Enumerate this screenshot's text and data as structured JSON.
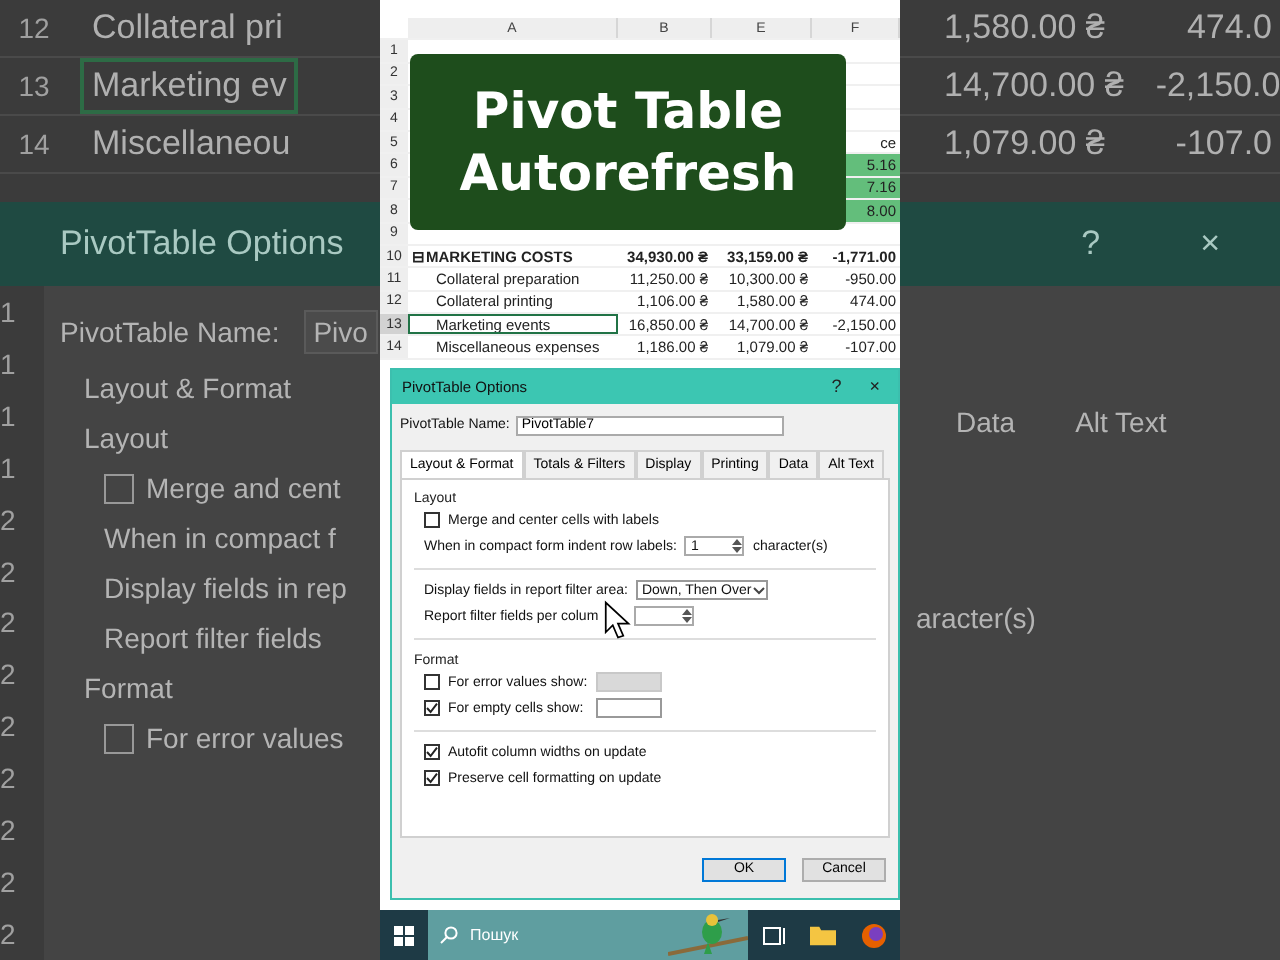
{
  "backdrop_left": {
    "rows": [
      {
        "number": "12",
        "label": "Collateral pri",
        "selected": false
      },
      {
        "number": "13",
        "label": "Marketing ev",
        "selected": true
      },
      {
        "number": "14",
        "label": "Miscellaneou",
        "selected": false
      }
    ],
    "dialog_title": "PivotTable Options",
    "name_label": "PivotTable Name:",
    "name_value": "Pivo",
    "tab": "Layout & Format",
    "section": "Layout",
    "lines": [
      {
        "kind": "check",
        "text": "Merge and cent",
        "checked": false
      },
      {
        "kind": "text",
        "text": "When in compact f"
      },
      {
        "kind": "text",
        "text": "Display fields in rep"
      },
      {
        "kind": "text",
        "text": "Report filter fields"
      },
      {
        "kind": "heading",
        "text": "Format"
      },
      {
        "kind": "check",
        "text": "For error values",
        "checked": false
      }
    ],
    "row_numbers": [
      "1",
      "1",
      "1",
      "1",
      "2",
      "2",
      "2",
      "2",
      "2",
      "2",
      "2",
      "2",
      "2"
    ]
  },
  "backdrop_right": {
    "rows": [
      [
        "1,580.00 ₴",
        "474.0"
      ],
      [
        "14,700.00 ₴",
        "-2,150.0"
      ],
      [
        "1,079.00 ₴",
        "-107.0"
      ]
    ],
    "help": "?",
    "close": "×",
    "tabs": [
      "Data",
      "Alt Text"
    ],
    "suffix": "aracter(s)"
  },
  "sheet": {
    "columns": [
      "A",
      "B",
      "E",
      "F"
    ],
    "rows": [
      {
        "number": "1",
        "cells": [
          "",
          "",
          "",
          ""
        ]
      },
      {
        "number": "2",
        "cells": [
          "",
          "",
          "",
          ""
        ]
      },
      {
        "number": "3",
        "cells": [
          "",
          "",
          "",
          ""
        ]
      },
      {
        "number": "4",
        "cells": [
          "",
          "",
          "",
          ""
        ]
      },
      {
        "number": "5",
        "cells": [
          "",
          "",
          "",
          "ce"
        ]
      },
      {
        "number": "6",
        "cells": [
          "",
          "",
          "",
          "5.16"
        ],
        "kind": "green"
      },
      {
        "number": "7",
        "cells": [
          "",
          "",
          "",
          "7.16"
        ],
        "kind": "green"
      },
      {
        "number": "8",
        "cells": [
          "",
          "",
          "",
          "8.00"
        ],
        "kind": "green"
      },
      {
        "number": "9",
        "cells": [
          "",
          "",
          "",
          ""
        ]
      },
      {
        "number": "10",
        "cells": [
          "⊟MARKETING COSTS",
          "34,930.00 ₴",
          "33,159.00 ₴",
          "-1,771.00"
        ],
        "kind": "bold"
      },
      {
        "number": "11",
        "cells": [
          "Collateral preparation",
          "11,250.00 ₴",
          "10,300.00 ₴",
          "-950.00"
        ]
      },
      {
        "number": "12",
        "cells": [
          "Collateral printing",
          "1,106.00 ₴",
          "1,580.00 ₴",
          "474.00"
        ]
      },
      {
        "number": "13",
        "cells": [
          "Marketing events",
          "16,850.00 ₴",
          "14,700.00 ₴",
          "-2,150.00"
        ],
        "selected": true
      },
      {
        "number": "14",
        "cells": [
          "Miscellaneous expenses",
          "1,186.00 ₴",
          "1,079.00 ₴",
          "-107.00"
        ]
      }
    ]
  },
  "title_card": {
    "lines": [
      "Pivot Table",
      "Autorefresh"
    ]
  },
  "dialog": {
    "title": "PivotTable Options",
    "help": "?",
    "close": "×",
    "name_label": "PivotTable Name:",
    "name_value": "PivotTable7",
    "tabs": [
      {
        "label": "Layout & Format",
        "selected": true
      },
      {
        "label": "Totals & Filters",
        "selected": false
      },
      {
        "label": "Display",
        "selected": false
      },
      {
        "label": "Printing",
        "selected": false
      },
      {
        "label": "Data",
        "selected": false
      },
      {
        "label": "Alt Text",
        "selected": false
      }
    ],
    "sections": [
      {
        "heading": "Layout",
        "items": [
          {
            "kind": "check",
            "label": "Merge and center cells with labels",
            "checked": false
          },
          {
            "kind": "spin",
            "label": "When in compact form indent row labels:",
            "value": "1",
            "suffix": "character(s)"
          }
        ]
      },
      {
        "items": [
          {
            "kind": "select",
            "label": "Display fields in report filter area:",
            "value": "Down, Then Over"
          },
          {
            "kind": "spin",
            "label": "Report filter fields per colum"
          }
        ]
      },
      {
        "heading": "Format",
        "items": [
          {
            "kind": "checkfield",
            "label": "For error values show:",
            "checked": false,
            "disabled": true
          },
          {
            "kind": "checkfield",
            "label": "For empty cells show:",
            "checked": true,
            "disabled": false
          }
        ]
      },
      {
        "items": [
          {
            "kind": "check",
            "label": "Autofit column widths on update",
            "checked": true
          },
          {
            "kind": "check",
            "label": "Preserve cell formatting on update",
            "checked": true
          }
        ]
      }
    ],
    "buttons": [
      {
        "label": "OK",
        "default": true
      },
      {
        "label": "Cancel",
        "default": false
      }
    ]
  },
  "taskbar": {
    "search_placeholder": "Пошук"
  }
}
